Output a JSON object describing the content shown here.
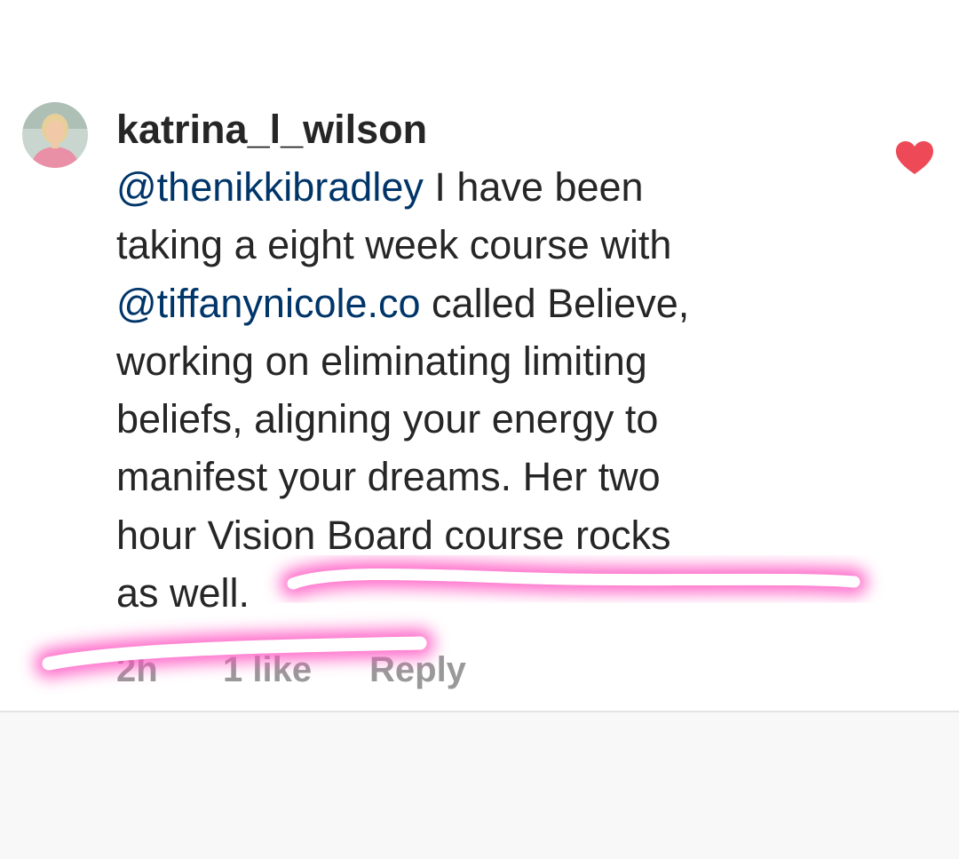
{
  "comment": {
    "username": "katrina_l_wilson",
    "body_lines": [
      [
        {
          "t": "@thenikkibradley",
          "mention": true
        },
        {
          "t": " I have been",
          "mention": false
        }
      ],
      [
        {
          "t": "taking a eight week course with",
          "mention": false
        }
      ],
      [
        {
          "t": "@tiffanynicole.co",
          "mention": true
        },
        {
          "t": " called Believe,",
          "mention": false
        }
      ],
      [
        {
          "t": "working on eliminating limiting",
          "mention": false
        }
      ],
      [
        {
          "t": "beliefs, aligning your energy to",
          "mention": false
        }
      ],
      [
        {
          "t": "manifest your dreams. Her two",
          "mention": false
        }
      ],
      [
        {
          "t": "hour Vision Board course rocks",
          "mention": false
        }
      ],
      [
        {
          "t": "as well.",
          "mention": false
        }
      ]
    ],
    "liked": true
  },
  "actions": {
    "time": "2h",
    "likes": "1 like",
    "reply": "Reply"
  },
  "icons": {
    "heart": "heart-filled-icon",
    "avatar": "profile-photo"
  },
  "colors": {
    "text": "#262626",
    "mention": "#003569",
    "meta": "#999999",
    "heart": "#ed4956",
    "highlight": "#ff4fc0"
  }
}
